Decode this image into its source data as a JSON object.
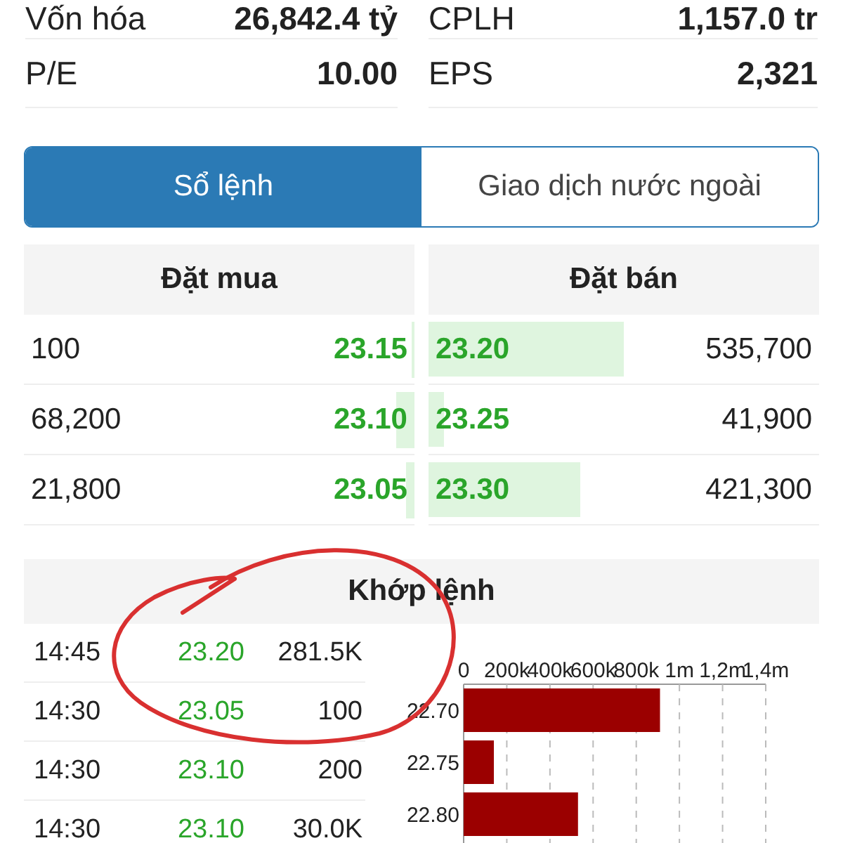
{
  "stats": [
    {
      "label": "Vốn hóa",
      "value": "26,842.4 tỷ"
    },
    {
      "label": "CPLH",
      "value": "1,157.0 tr"
    },
    {
      "label": "P/E",
      "value": "10.00"
    },
    {
      "label": "EPS",
      "value": "2,321"
    }
  ],
  "tabs": [
    {
      "label": "Sổ lệnh",
      "selected": true
    },
    {
      "label": "Giao dịch nước ngoài",
      "selected": false
    }
  ],
  "order_book": {
    "buy_title": "Đặt mua",
    "sell_title": "Đặt bán",
    "rows": [
      {
        "buy_volume": "100",
        "buy_price": "23.15",
        "buy_depth": {
          "level": 0.01
        },
        "sell_price": "23.20",
        "sell_volume": "535,700",
        "sell_depth": {
          "level": 0.5
        }
      },
      {
        "buy_volume": "68,200",
        "buy_price": "23.10",
        "buy_depth": {
          "level": 0.065
        },
        "sell_price": "23.25",
        "sell_volume": "41,900",
        "sell_depth": {
          "level": 0.04
        }
      },
      {
        "buy_volume": "21,800",
        "buy_price": "23.05",
        "buy_depth": {
          "level": 0.03
        },
        "sell_price": "23.30",
        "sell_volume": "421,300",
        "sell_depth": {
          "level": 0.39
        }
      }
    ]
  },
  "matched": {
    "title": "Khớp lệnh",
    "trades": [
      {
        "time": "14:45",
        "price": "23.20",
        "volume": "281.5K"
      },
      {
        "time": "14:30",
        "price": "23.05",
        "volume": "100"
      },
      {
        "time": "14:30",
        "price": "23.10",
        "volume": "200"
      },
      {
        "time": "14:30",
        "price": "23.10",
        "volume": "30.0K"
      }
    ],
    "chart_data": {
      "type": "bar",
      "orientation": "horizontal",
      "categories": [
        "22.70",
        "22.75",
        "22.80"
      ],
      "values": [
        910000,
        140000,
        530000
      ],
      "xlim": [
        0,
        1400000
      ],
      "grid": true,
      "xticks": [
        {
          "value": 0,
          "label": "0"
        },
        {
          "value": 200000,
          "label": "200k"
        },
        {
          "value": 400000,
          "label": "400k"
        },
        {
          "value": 600000,
          "label": "600k"
        },
        {
          "value": 800000,
          "label": "800k"
        },
        {
          "value": 1000000,
          "label": "1m"
        },
        {
          "value": 1200000,
          "label": "1,2m"
        },
        {
          "value": 1400000,
          "label": "1,4m"
        }
      ]
    }
  }
}
